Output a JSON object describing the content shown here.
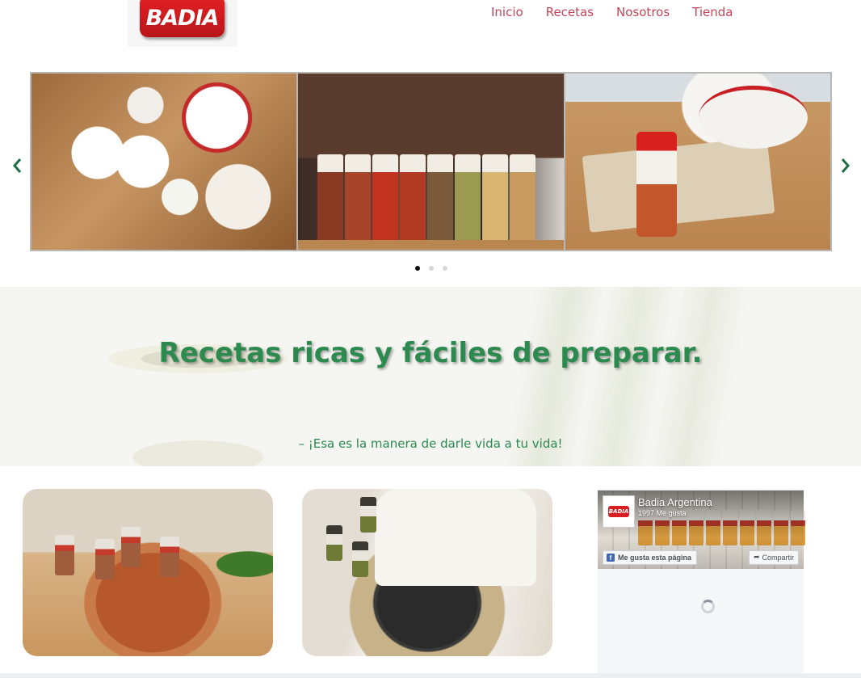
{
  "header": {
    "logo_text": "BADIA",
    "nav": [
      "Inicio",
      "Recetas",
      "Nosotros",
      "Tienda"
    ]
  },
  "slider": {
    "slide_count": 3,
    "active_index": 0
  },
  "hero": {
    "title": "Recetas ricas y fáciles de preparar.",
    "subtitle": "– ¡Esa es la manera de darle vida a tu vida!"
  },
  "facebook": {
    "page_name": "Badia Argentina",
    "likes": "1997 Me gusta",
    "like_button": "Me gusta esta página",
    "share_button": "Compartir",
    "avatar_text": "BADIA"
  },
  "colors": {
    "nav": "#c0475a",
    "brand_red": "#d81e22",
    "hero_green": "#2c8a4f"
  },
  "icons": {
    "prev": "chevron-left-icon",
    "next": "chevron-right-icon",
    "facebook": "facebook-icon",
    "share": "share-arrow-icon",
    "loading": "spinner-icon"
  }
}
